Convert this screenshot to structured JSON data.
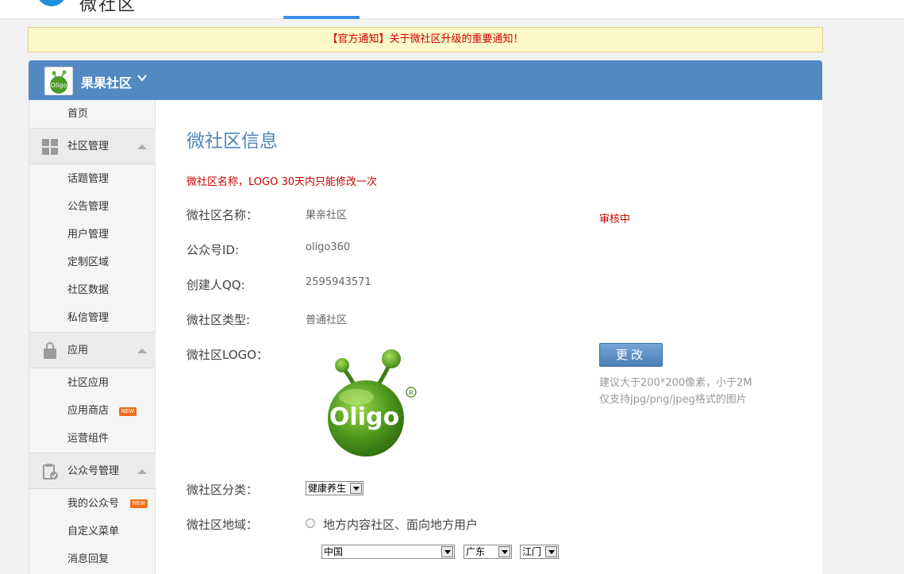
{
  "topbar": {
    "logo_text": "微社区"
  },
  "notice": {
    "text": "【官方通知】关于微社区升级的重要通知！"
  },
  "header": {
    "community_name": "果果社区"
  },
  "sidebar": {
    "home": "首页",
    "groups": [
      {
        "label": "社区管理",
        "icon": "grid-icon",
        "items": [
          "话题管理",
          "公告管理",
          "用户管理",
          "定制区域",
          "社区数据",
          "私信管理"
        ]
      },
      {
        "label": "应用",
        "icon": "bag-icon",
        "items": [
          "社区应用",
          "应用商店",
          "运营组件"
        ]
      },
      {
        "label": "公众号管理",
        "icon": "clipboard-check-icon",
        "items": [
          "我的公众号",
          "自定义菜单",
          "消息回复"
        ]
      }
    ],
    "new_badge": "NEW"
  },
  "main": {
    "title": "微社区信息",
    "warning": "微社区名称，LOGO 30天内只能修改一次",
    "status": "审核中",
    "fields": {
      "name_label": "微社区名称：",
      "name_value": "果亲社区",
      "account_label": "公众号ID:",
      "account_value": "oligo360",
      "qq_label": "创建人QQ:",
      "qq_value": "2595943571",
      "type_label": "微社区类型:",
      "type_value": "普通社区",
      "logo_label": "微社区LOGO：",
      "category_label": "微社区分类：",
      "category_value": "健康养生",
      "region_label": "微社区地域：",
      "region_option": "地方内容社区、面向地方用户",
      "country": "中国",
      "province": "广东",
      "city": "江门"
    },
    "logo_text": "Oligo",
    "change_button": "更改",
    "hint1": "建议大于200*200像素，小于2M",
    "hint2": "仅支持jpg/png/jpeg格式的图片"
  }
}
